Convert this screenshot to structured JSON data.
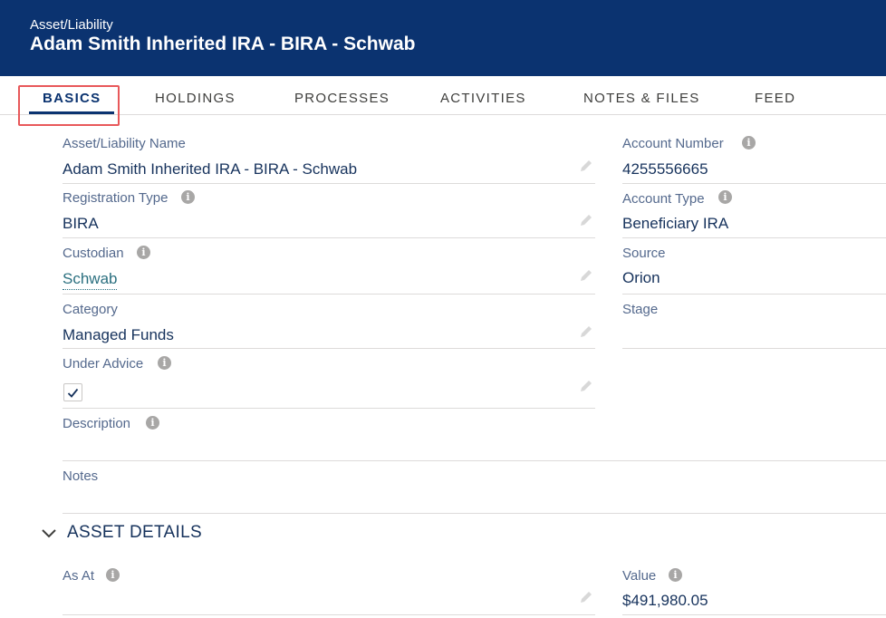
{
  "header": {
    "object_label": "Asset/Liability",
    "record_title": "Adam Smith Inherited IRA - BIRA - Schwab"
  },
  "tabs": [
    {
      "label": "BASICS",
      "active": true
    },
    {
      "label": "HOLDINGS",
      "active": false
    },
    {
      "label": "PROCESSES",
      "active": false
    },
    {
      "label": "ACTIVITIES",
      "active": false
    },
    {
      "label": "NOTES & FILES",
      "active": false
    },
    {
      "label": "FEED",
      "active": false
    }
  ],
  "fields": {
    "asset_name": {
      "label": "Asset/Liability Name",
      "value": "Adam Smith Inherited IRA - BIRA - Schwab"
    },
    "registration_type": {
      "label": "Registration Type",
      "value": "BIRA"
    },
    "custodian": {
      "label": "Custodian",
      "value": "Schwab"
    },
    "category": {
      "label": "Category",
      "value": "Managed Funds"
    },
    "under_advice": {
      "label": "Under Advice",
      "checked": true
    },
    "description": {
      "label": "Description",
      "value": ""
    },
    "notes": {
      "label": "Notes",
      "value": ""
    },
    "account_number": {
      "label": "Account Number",
      "value": "4255556665"
    },
    "account_type": {
      "label": "Account Type",
      "value": "Beneficiary IRA"
    },
    "source": {
      "label": "Source",
      "value": "Orion"
    },
    "stage": {
      "label": "Stage",
      "value": ""
    }
  },
  "asset_details": {
    "section_title": "ASSET DETAILS",
    "as_at": {
      "label": "As At",
      "value": ""
    },
    "value": {
      "label": "Value",
      "value": "$491,980.05"
    }
  },
  "colors": {
    "header_bg": "#0b3370",
    "tab_highlight": "#e8585a",
    "link": "#2a6f7f"
  }
}
